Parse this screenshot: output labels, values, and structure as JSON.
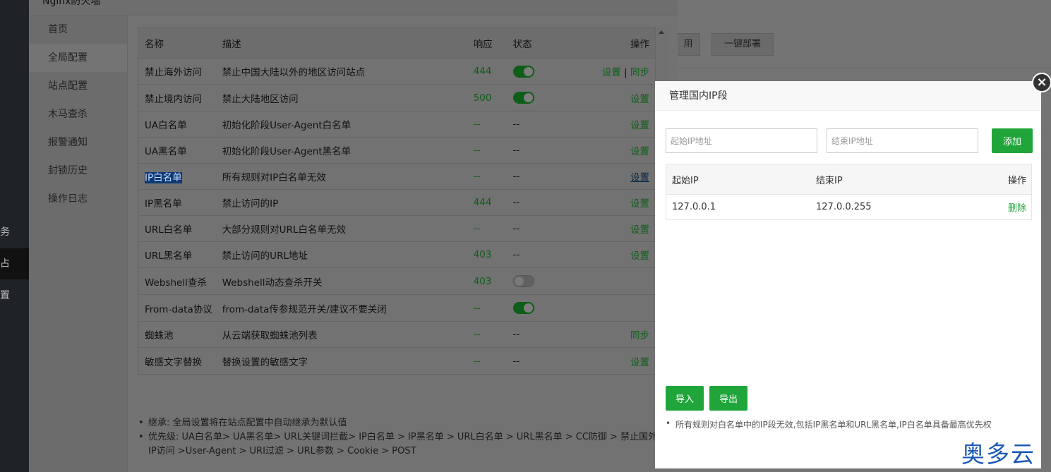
{
  "background": {
    "sidebar_fragments": [
      "务",
      "占",
      "置"
    ],
    "buttons": [
      "用",
      "一键部署"
    ]
  },
  "firewall": {
    "window_title": "Nginx防火墙",
    "nav": [
      {
        "label": "首页"
      },
      {
        "label": "全局配置"
      },
      {
        "label": "站点配置"
      },
      {
        "label": "木马查杀"
      },
      {
        "label": "报警通知"
      },
      {
        "label": "封锁历史"
      },
      {
        "label": "操作日志"
      }
    ],
    "table": {
      "headers": {
        "name": "名称",
        "desc": "描述",
        "resp": "响应",
        "state": "状态",
        "op": "操作"
      },
      "rows": [
        {
          "name": "禁止海外访问",
          "desc": "禁止中国大陆以外的地区访问站点",
          "resp": "444",
          "state": "on",
          "op1": "设置",
          "sep": "|",
          "op2": "同步"
        },
        {
          "name": "禁止境内访问",
          "desc": "禁止大陆地区访问",
          "resp": "500",
          "state": "on",
          "op1": "设置"
        },
        {
          "name": "UA白名单",
          "desc": "初始化阶段User-Agent白名单",
          "resp": "--",
          "state_text": "--",
          "op1": "设置"
        },
        {
          "name": "UA黑名单",
          "desc": "初始化阶段User-Agent黑名单",
          "resp": "--",
          "state_text": "--",
          "op1": "设置"
        },
        {
          "name": "IP白名单",
          "desc": "所有规则对IP白名单无效",
          "resp": "--",
          "state_text": "--",
          "op1": "设置"
        },
        {
          "name": "IP黑名单",
          "desc": "禁止访问的IP",
          "resp": "444",
          "state_text": "--",
          "op1": "设置"
        },
        {
          "name": "URL白名单",
          "desc": "大部分规则对URL白名单无效",
          "resp": "--",
          "state_text": "--",
          "op1": "设置"
        },
        {
          "name": "URL黑名单",
          "desc": "禁止访问的URL地址",
          "resp": "403",
          "state_text": "--",
          "op1": "设置"
        },
        {
          "name": "Webshell查杀",
          "desc": "Webshell动态查杀开关",
          "resp": "403",
          "state": "off",
          "op1": ""
        },
        {
          "name": "From-data协议",
          "desc": "from-data传参规范开关/建议不要关闭",
          "resp": "--",
          "state": "on",
          "op1": ""
        },
        {
          "name": "蜘蛛池",
          "desc": "从云端获取蜘蛛池列表",
          "resp": "--",
          "state_text": "--",
          "op1": "同步"
        },
        {
          "name": "敏感文字替换",
          "desc": "替换设置的敏感文字",
          "resp": "--",
          "state_text": "--",
          "op1": "设置"
        }
      ]
    },
    "notes": [
      "继承: 全局设置将在站点配置中自动继承为默认值",
      "优先级: UA白名单> UA黑名单> URL关键词拦截> IP白名单 > IP黑名单 > URL白名单 > URL黑名单 > CC防御 > 禁止国外IP访问 >User-Agent > URI过滤 > URL参数 > Cookie > POST"
    ]
  },
  "modal": {
    "title": "管理国内IP段",
    "start_placeholder": "起始IP地址",
    "end_placeholder": "结束IP地址",
    "add_label": "添加",
    "table_headers": {
      "start": "起始IP",
      "end": "结束IP",
      "op": "操作"
    },
    "rows": [
      {
        "start": "127.0.0.1",
        "end": "127.0.0.255",
        "op": "删除"
      }
    ],
    "import_label": "导入",
    "export_label": "导出",
    "note": "所有规则对白名单中的IP段无效,包括IP黑名单和URL黑名单,IP白名单具备最高优先权",
    "close_glyph": "×"
  },
  "watermark": "奥多云",
  "colors": {
    "accent_green": "#20a53a",
    "watermark_blue": "#1b59b8"
  }
}
